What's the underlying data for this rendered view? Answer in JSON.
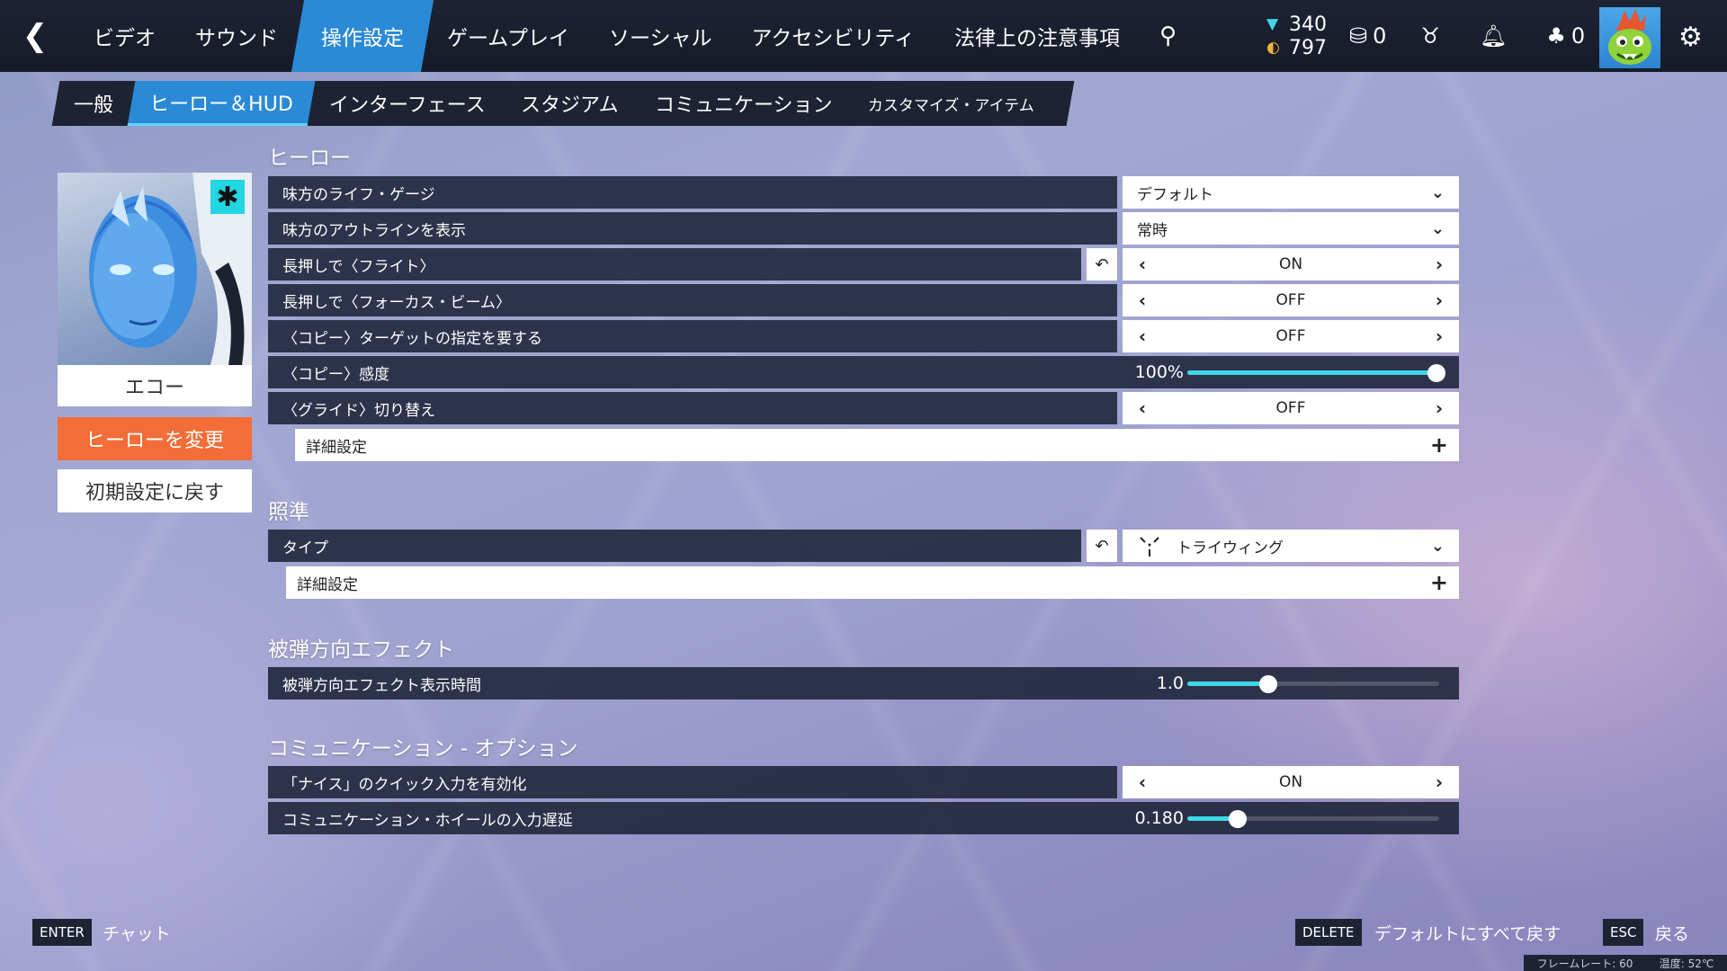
{
  "topbar": {
    "tabs": [
      "ビデオ",
      "サウンド",
      "操作設定",
      "ゲームプレイ",
      "ソーシャル",
      "アクセシビリティ",
      "法律上の注意事項"
    ],
    "active_tab": "操作設定",
    "currency": {
      "legacy_credits": "340",
      "coins": "797"
    },
    "counts": {
      "loot": "0",
      "friends": "0"
    }
  },
  "subtabs": [
    "一般",
    "ヒーロー＆HUD",
    "インターフェース",
    "スタジアム",
    "コミュニケーション",
    "カスタマイズ・アイテム"
  ],
  "hero": {
    "name": "エコー",
    "change_label": "ヒーローを変更",
    "reset_label": "初期設定に戻す"
  },
  "sections": {
    "hero": "ヒーロー",
    "reticle": "照準",
    "damage": "被弾方向エフェクト",
    "comm": "コミュニケーション - オプション"
  },
  "settings": {
    "ally_health": {
      "label": "味方のライフ・ゲージ",
      "value": "デフォルト"
    },
    "ally_outline": {
      "label": "味方のアウトラインを表示",
      "value": "常時"
    },
    "hold_flight": {
      "label": "長押しで〈フライト〉",
      "value": "ON"
    },
    "hold_beam": {
      "label": "長押しで〈フォーカス・ビーム〉",
      "value": "OFF"
    },
    "duplicate_target": {
      "label": "〈コピー〉ターゲットの指定を要する",
      "value": "OFF"
    },
    "duplicate_sens": {
      "label": "〈コピー〉感度",
      "value": "100%",
      "level": 0.99
    },
    "glide_toggle": {
      "label": "〈グライド〉切り替え",
      "value": "OFF"
    },
    "hero_advanced": {
      "label": "詳細設定"
    },
    "reticle_type": {
      "label": "タイプ",
      "value": "トライウィング"
    },
    "reticle_advanced": {
      "label": "詳細設定"
    },
    "damage_duration": {
      "label": "被弾方向エフェクト表示時間",
      "value": "1.0",
      "level": 0.32
    },
    "nice_quick": {
      "label": "「ナイス」のクイック入力を有効化",
      "value": "ON"
    },
    "wheel_delay": {
      "label": "コミュニケーション・ホイールの入力遅延",
      "value": "0.180",
      "level": 0.2
    }
  },
  "footer": {
    "enter_key": "ENTER",
    "enter_label": "チャット",
    "delete_key": "DELETE",
    "delete_label": "デフォルトにすべて戻す",
    "esc_key": "ESC",
    "esc_label": "戻る",
    "framerate": "フレームレート: 60",
    "temp": "温度: 52℃"
  },
  "colors": {
    "accent": "#2a8ad6",
    "slider": "#3fd8e8",
    "orange": "#f26d38"
  },
  "icons": [
    "back-arrow-icon",
    "search-icon",
    "legacy-credit-icon",
    "coin-icon",
    "loot-icon",
    "challenges-icon",
    "bell-icon",
    "friends-icon",
    "gear-icon",
    "reset-icon",
    "chevron-down-icon",
    "arrow-left-icon",
    "arrow-right-icon",
    "plus-icon"
  ]
}
